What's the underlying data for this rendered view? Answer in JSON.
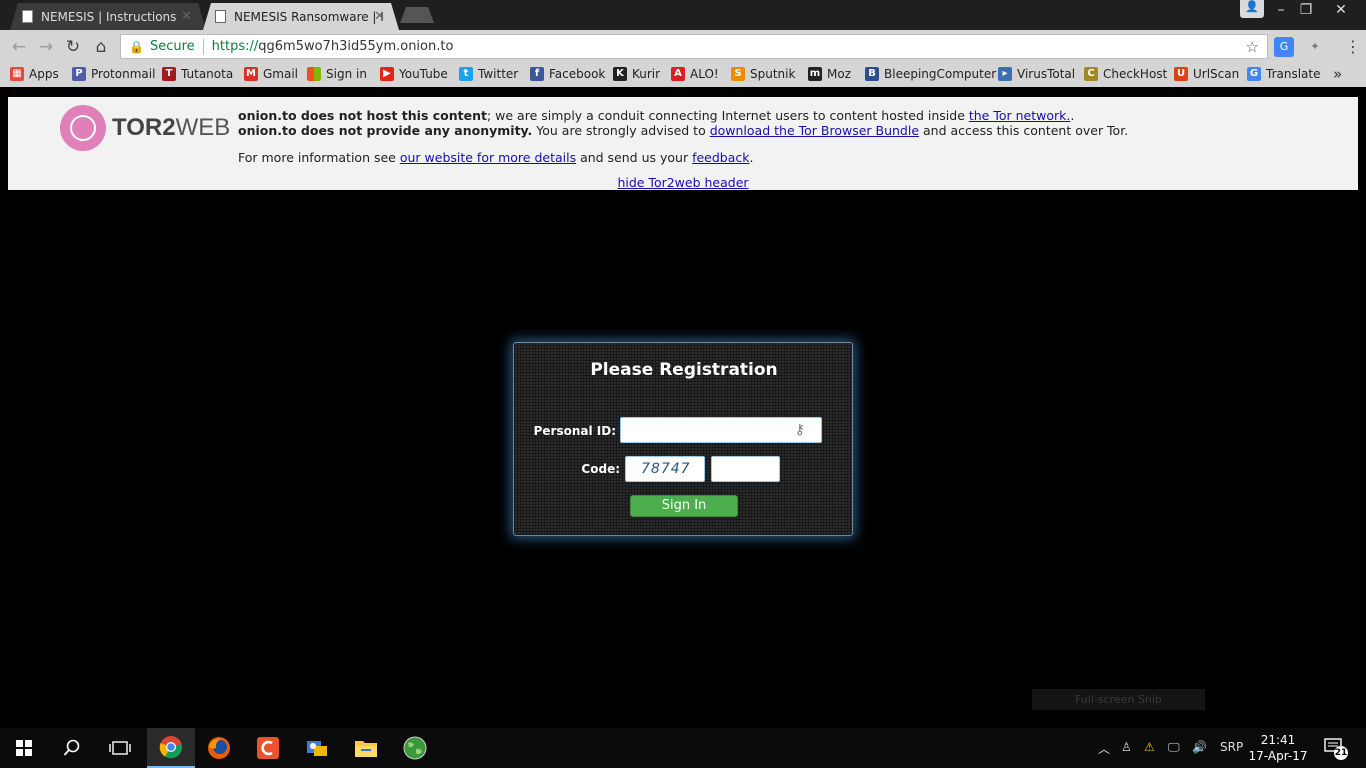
{
  "tabs": [
    {
      "title": "NEMESIS | Instructions",
      "active": false
    },
    {
      "title": "NEMESIS Ransomware | I",
      "active": true
    }
  ],
  "toolbar": {
    "secure_label": "Secure",
    "url_scheme": "https://",
    "url_host": "qg6m5wo7h3id55ym.onion.to"
  },
  "bookmarks": [
    {
      "label": "Apps",
      "icon": "apps-grid-icon",
      "color": "#e04a3f"
    },
    {
      "label": "Protonmail",
      "icon": "protonmail-icon",
      "color": "#505ca6"
    },
    {
      "label": "Tutanota",
      "icon": "tutanota-icon",
      "color": "#a01c1c"
    },
    {
      "label": "Gmail",
      "icon": "gmail-icon",
      "color": "#d93025"
    },
    {
      "label": "Sign in",
      "icon": "microsoft-icon",
      "color": "#f25022"
    },
    {
      "label": "YouTube",
      "icon": "youtube-icon",
      "color": "#e62117"
    },
    {
      "label": "Twitter",
      "icon": "twitter-icon",
      "color": "#1da1f2"
    },
    {
      "label": "Facebook",
      "icon": "facebook-icon",
      "color": "#3b5998"
    },
    {
      "label": "Kurir",
      "icon": "kurir-icon",
      "color": "#222222"
    },
    {
      "label": "ALO!",
      "icon": "alo-icon",
      "color": "#d91f26"
    },
    {
      "label": "Sputnik",
      "icon": "sputnik-icon",
      "color": "#f08a00"
    },
    {
      "label": "Moz",
      "icon": "moz-icon",
      "color": "#222222"
    },
    {
      "label": "BleepingComputer",
      "icon": "bleepingcomputer-icon",
      "color": "#2c4f8c"
    },
    {
      "label": "VirusTotal",
      "icon": "virustotal-icon",
      "color": "#3a6fb0"
    },
    {
      "label": "CheckHost",
      "icon": "checkhost-icon",
      "color": "#a08a20"
    },
    {
      "label": "UrlScan",
      "icon": "urlscan-icon",
      "color": "#d84315"
    },
    {
      "label": "Translate",
      "icon": "translate-icon",
      "color": "#4285f4"
    }
  ],
  "tor2web": {
    "line1_bold": "onion.to does not host this content",
    "line1_rest": "; we are simply a conduit connecting Internet users to content hosted inside ",
    "line1_link": "the Tor network.",
    "line1_end": ".",
    "line2_bold": "onion.to does not provide any anonymity.",
    "line2_rest": " You are strongly advised to ",
    "line2_link": "download the Tor Browser Bundle",
    "line2_end": " and access this content over Tor.",
    "line3_start": "For more information see ",
    "line3_link1": "our website for more details",
    "line3_mid": " and send us your ",
    "line3_link2": "feedback",
    "line3_end": ".",
    "hide_link": "hide Tor2web header",
    "logo_text_bold": "TOR2",
    "logo_text_rest": "WEB"
  },
  "login": {
    "title": "Please Registration",
    "personal_id_label": "Personal ID:",
    "code_label": "Code:",
    "captcha_value": "78747",
    "signin_label": "Sign In"
  },
  "snip_label": "Full-screen Snip",
  "taskbar": {
    "language": "SRP",
    "time": "21:41",
    "date": "17-Apr-17",
    "notification_count": "21"
  },
  "colors": {
    "panel_glow": "#4696dc",
    "signin_green": "#4cae4c",
    "link_blue": "#1a0dab",
    "secure_green": "#0b8043"
  }
}
